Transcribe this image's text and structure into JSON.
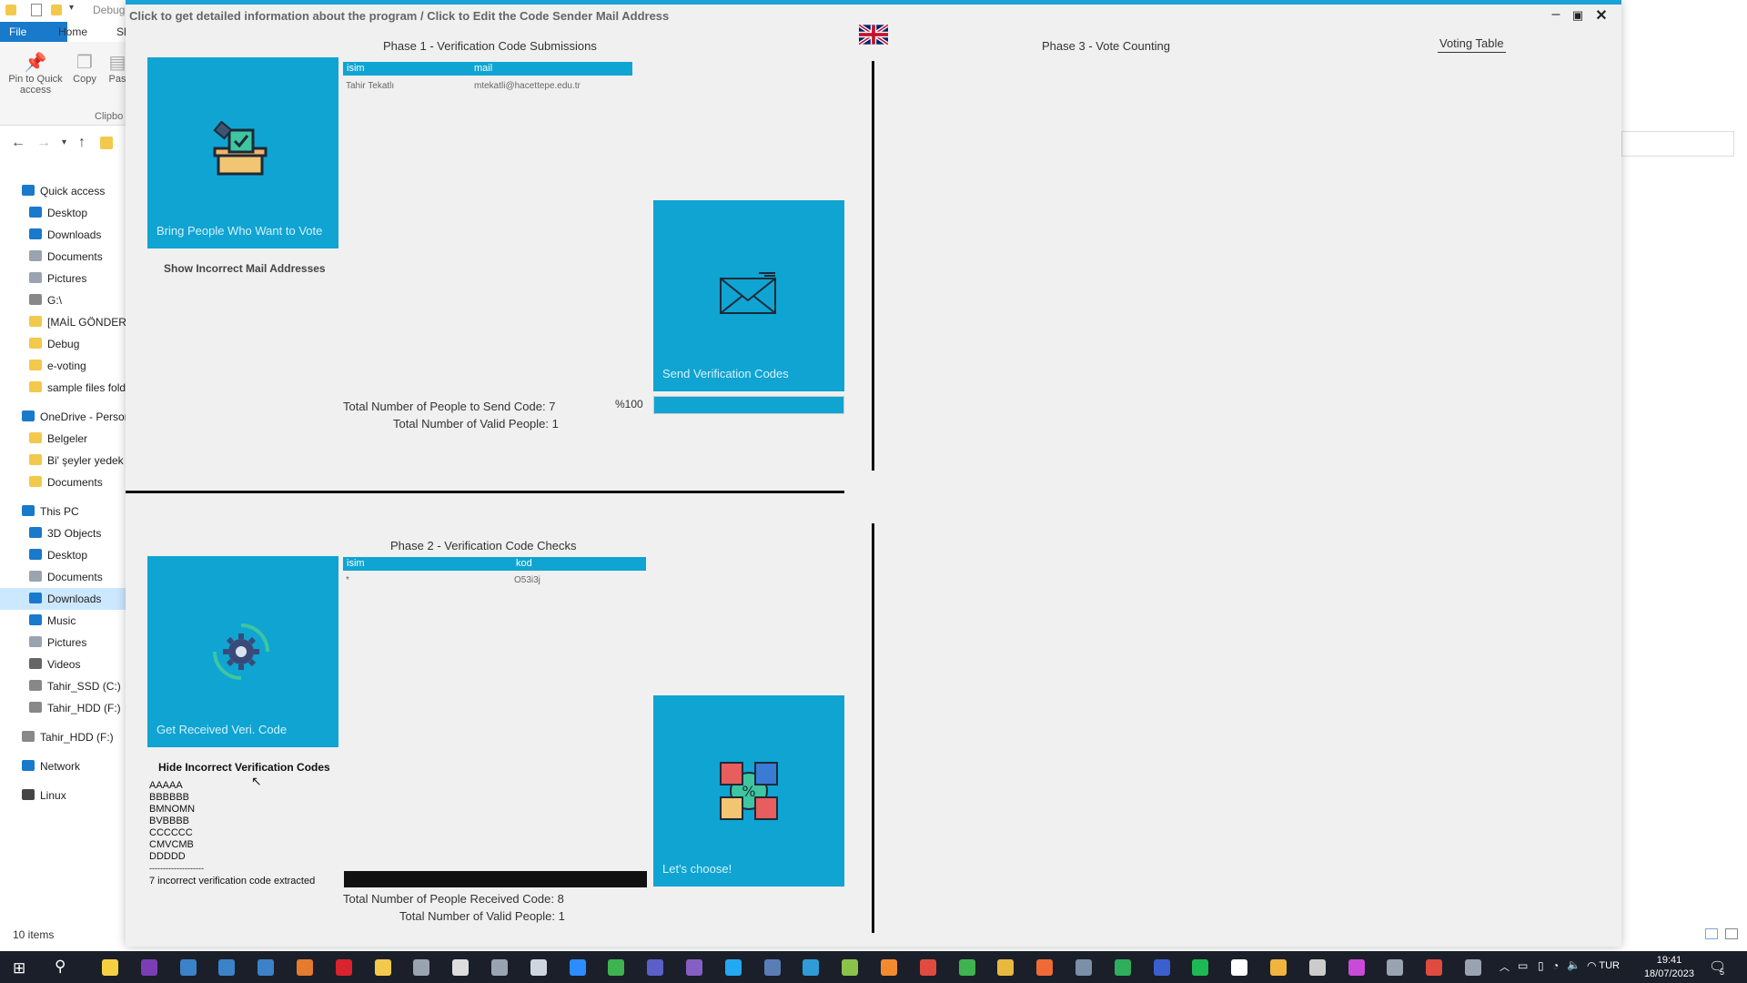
{
  "explorer": {
    "title_partial": "Debug",
    "ribbon_tabs": [
      "File",
      "Home",
      "Sh"
    ],
    "ribbon_buttons": [
      "Pin to Quick access",
      "Copy",
      "Pas"
    ],
    "ribbon_group": "Clipbo",
    "nav": [
      {
        "label": "Quick access",
        "icon": "star-icon",
        "level": 0
      },
      {
        "label": "Desktop",
        "icon": "desktop-folder-icon",
        "level": 1
      },
      {
        "label": "Downloads",
        "icon": "download-icon",
        "level": 1
      },
      {
        "label": "Documents",
        "icon": "documents-icon",
        "level": 1
      },
      {
        "label": "Pictures",
        "icon": "pictures-icon",
        "level": 1
      },
      {
        "label": "G:\\",
        "icon": "drive-icon",
        "level": 1
      },
      {
        "label": "[MAİL GÖNDERİ",
        "icon": "folder-icon",
        "level": 1
      },
      {
        "label": "Debug",
        "icon": "folder-icon",
        "level": 1
      },
      {
        "label": "e-voting",
        "icon": "folder-icon",
        "level": 1
      },
      {
        "label": "sample files fold",
        "icon": "folder-icon",
        "level": 1
      },
      {
        "label": "OneDrive - Persor",
        "icon": "cloud-icon",
        "level": 0
      },
      {
        "label": "Belgeler",
        "icon": "folder-icon",
        "level": 1
      },
      {
        "label": "Bi' şeyler yedek",
        "icon": "folder-icon",
        "level": 1
      },
      {
        "label": "Documents",
        "icon": "folder-icon",
        "level": 1
      },
      {
        "label": "This PC",
        "icon": "pc-icon",
        "level": 0
      },
      {
        "label": "3D Objects",
        "icon": "cube-icon",
        "level": 1
      },
      {
        "label": "Desktop",
        "icon": "desktop-folder-icon",
        "level": 1
      },
      {
        "label": "Documents",
        "icon": "documents-icon",
        "level": 1
      },
      {
        "label": "Downloads",
        "icon": "download-icon",
        "level": 1,
        "selected": true
      },
      {
        "label": "Music",
        "icon": "music-icon",
        "level": 1
      },
      {
        "label": "Pictures",
        "icon": "pictures-icon",
        "level": 1
      },
      {
        "label": "Videos",
        "icon": "videos-icon",
        "level": 1
      },
      {
        "label": "Tahir_SSD (C:)",
        "icon": "drive-icon",
        "level": 1
      },
      {
        "label": "Tahir_HDD (F:)",
        "icon": "drive-icon",
        "level": 1
      },
      {
        "label": "Tahir_HDD (F:)",
        "icon": "drive-icon",
        "level": 0
      },
      {
        "label": "Network",
        "icon": "network-icon",
        "level": 0
      },
      {
        "label": "Linux",
        "icon": "linux-icon",
        "level": 0
      }
    ],
    "status_items": "10 items"
  },
  "app": {
    "title": "Click to get detailed information about the program / Click to Edit the Code Sender Mail Address",
    "voting_table_link": "Voting Table",
    "phase1": {
      "title": "Phase 1 - Verification Code Submissions",
      "tile_bring": "Bring People Who Want to Vote",
      "show_incorrect_mail": "Show Incorrect Mail Addresses",
      "grid_headers": [
        "isim",
        "mail"
      ],
      "grid_rows": [
        [
          "Tahir Tekatlı",
          "mtekatli@hacettepe.edu.tr"
        ]
      ],
      "tile_send": "Send Verification Codes",
      "progress_percent": "%100",
      "progress_value": 1.0,
      "total_send": "Total Number of People to Send Code: 7",
      "total_valid": "Total Number of Valid People: 1"
    },
    "phase2": {
      "title": "Phase 2 - Verification Code Checks",
      "tile_get": "Get Received Veri. Code",
      "hide_incorrect": "Hide Incorrect Verification Codes",
      "incorrect_codes": [
        "AAAAA",
        "BBBBBB",
        "BMNOMN",
        "BVBBBB",
        "CCCCCC",
        "CMVCMB",
        "DDDDD"
      ],
      "separator": "--------------------",
      "extracted": "7 incorrect verification code extracted",
      "grid_headers": [
        "isim",
        "kod"
      ],
      "grid_rows": [
        [
          "*",
          "O53i3j"
        ]
      ],
      "tile_choose": "Let's choose!",
      "total_received": "Total Number of People Received Code: 8",
      "total_valid": "Total Number of Valid People: 1"
    },
    "phase3": {
      "title": "Phase 3 - Vote Counting"
    }
  },
  "taskbar": {
    "lang": "TUR",
    "time": "19:41",
    "date": "18/07/2023",
    "notifications": "5"
  }
}
